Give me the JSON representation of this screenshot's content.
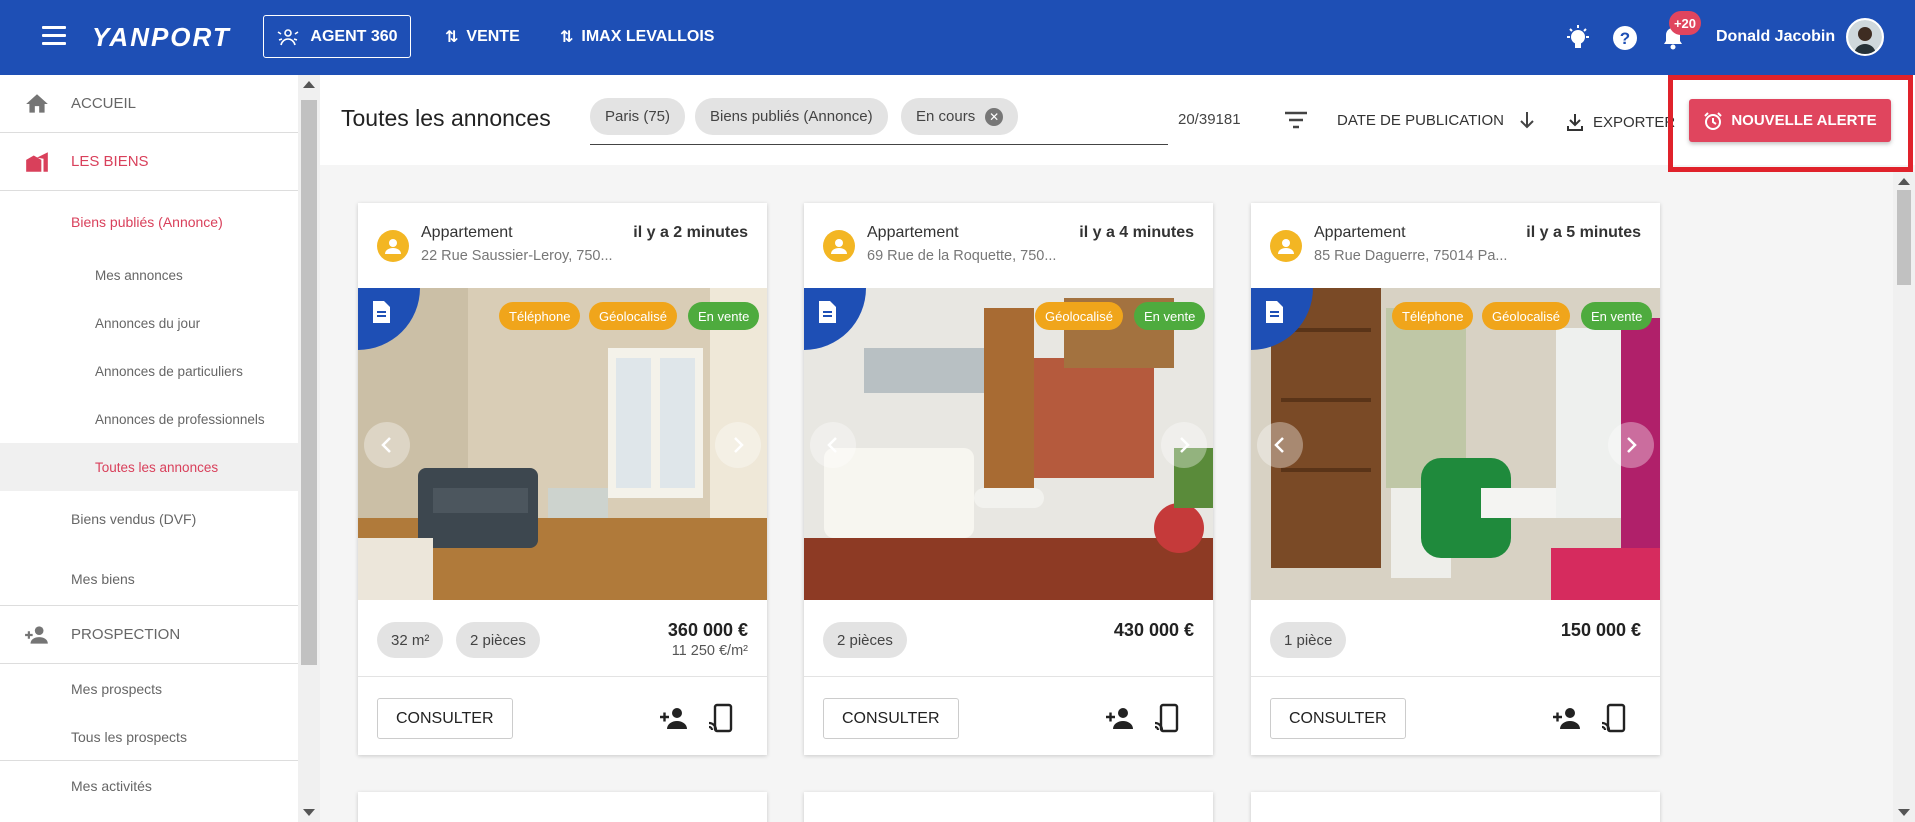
{
  "header": {
    "logo": "YANPORT",
    "agent_button": "AGENT 360",
    "nav": [
      "VENTE",
      "IMAX LEVALLOIS"
    ],
    "notifications_badge": "+20",
    "user_name": "Donald Jacobin",
    "background_color": "#1e4fb5"
  },
  "sidebar": {
    "accueil": "ACCUEIL",
    "les_biens": "LES BIENS",
    "biens_publies": "Biens publiés (Annonce)",
    "mes_annonces": "Mes annonces",
    "annonces_du_jour": "Annonces du jour",
    "annonces_particuliers": "Annonces de particuliers",
    "annonces_professionnels": "Annonces de professionnels",
    "toutes_annonces": "Toutes les annonces",
    "biens_vendus": "Biens vendus (DVF)",
    "mes_biens": "Mes biens",
    "prospection": "PROSPECTION",
    "mes_prospects": "Mes prospects",
    "tous_prospects": "Tous les prospects",
    "mes_activites": "Mes activités",
    "accent_color": "#d9405b"
  },
  "toolbar": {
    "title": "Toutes les annonces",
    "chips": [
      "Paris (75)",
      "Biens publiés (Annonce)",
      "En cours"
    ],
    "count": "20/39181",
    "sort_label": "DATE DE PUBLICATION",
    "export_label": "EXPORTER",
    "alert_button": "NOUVELLE ALERTE"
  },
  "cards": [
    {
      "type": "Appartement",
      "address": "22 Rue Saussier-Leroy, 750...",
      "time": "il y a 2 minutes",
      "tags": [
        "Téléphone",
        "Géolocalisé",
        "En vente"
      ],
      "chips": [
        "32 m²",
        "2 pièces"
      ],
      "price": "360 000 €",
      "price_per_m2": "11 250 €/m²",
      "consult": "CONSULTER"
    },
    {
      "type": "Appartement",
      "address": "69 Rue de la Roquette, 750...",
      "time": "il y a 4 minutes",
      "tags": [
        "Géolocalisé",
        "En vente"
      ],
      "chips": [
        "2 pièces"
      ],
      "price": "430 000 €",
      "price_per_m2": "",
      "consult": "CONSULTER"
    },
    {
      "type": "Appartement",
      "address": "85 Rue Daguerre, 75014 Pa...",
      "time": "il y a 5 minutes",
      "tags": [
        "Téléphone",
        "Géolocalisé",
        "En vente"
      ],
      "chips": [
        "1 pièce"
      ],
      "price": "150 000 €",
      "price_per_m2": "",
      "consult": "CONSULTER"
    }
  ]
}
